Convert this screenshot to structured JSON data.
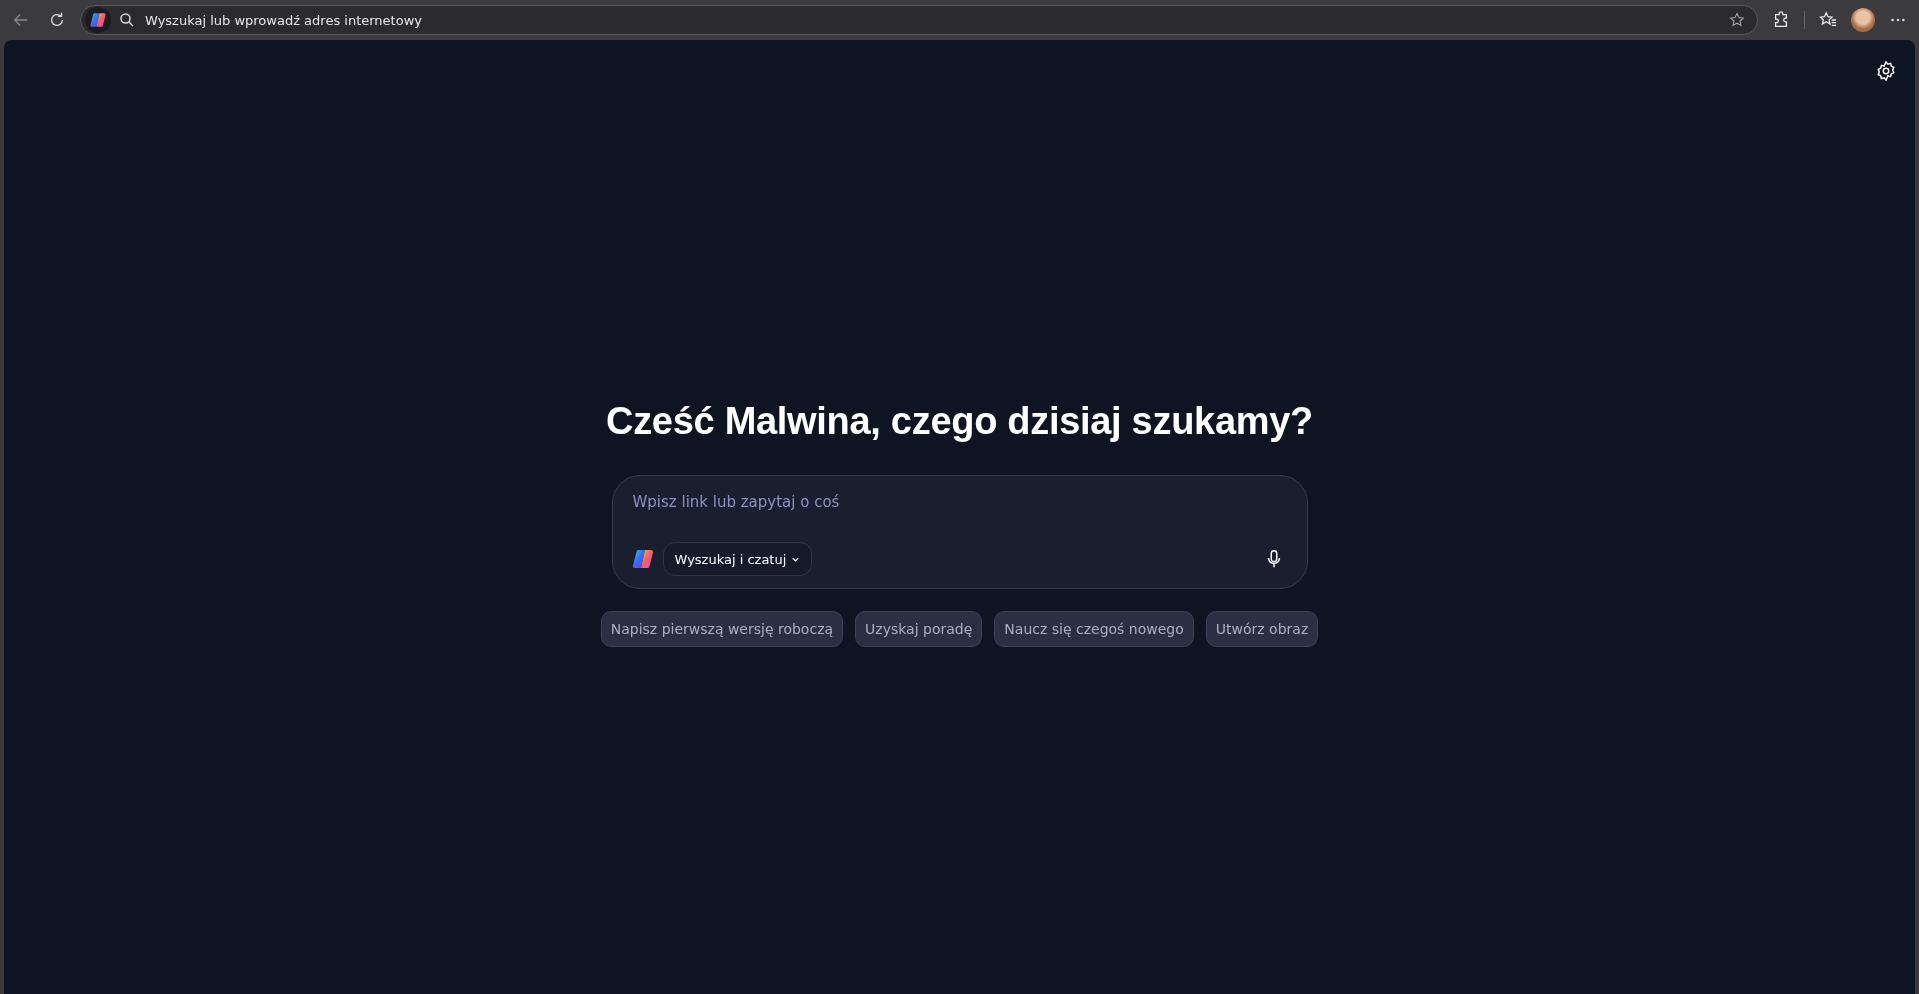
{
  "browser": {
    "address_bar": {
      "placeholder": "Wyszukaj lub wprowadź adres internetowy"
    }
  },
  "page": {
    "greeting": "Cześć Malwina, czego dzisiaj szukamy?",
    "composer": {
      "placeholder": "Wpisz link lub zapytaj o coś",
      "mode_button": "Wyszukaj i czatuj"
    },
    "suggestions": [
      "Napisz pierwszą wersję roboczą",
      "Uzyskaj poradę",
      "Naucz się czegoś nowego",
      "Utwórz obraz"
    ]
  }
}
